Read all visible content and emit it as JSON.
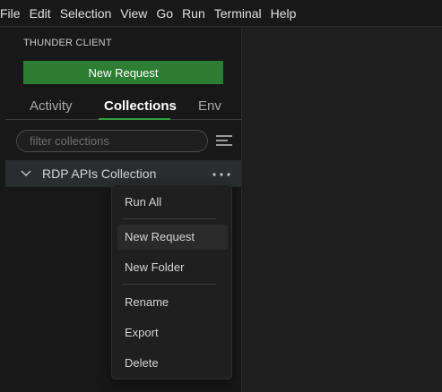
{
  "menubar": {
    "items": [
      "File",
      "Edit",
      "Selection",
      "View",
      "Go",
      "Run",
      "Terminal",
      "Help"
    ]
  },
  "sidebar": {
    "title": "THUNDER CLIENT",
    "new_request_label": "New Request",
    "tabs": [
      {
        "label": "Activity",
        "active": false
      },
      {
        "label": "Collections",
        "active": true
      },
      {
        "label": "Env",
        "active": false
      }
    ],
    "filter_placeholder": "filter collections",
    "collection": {
      "name": "RDP APIs Collection",
      "expanded": false
    }
  },
  "context_menu": {
    "items": [
      {
        "label": "Run All"
      },
      {
        "label": "New Request",
        "hovered": true
      },
      {
        "label": "New Folder"
      },
      {
        "label": "Rename"
      },
      {
        "label": "Export"
      },
      {
        "label": "Delete"
      }
    ]
  },
  "colors": {
    "accent_green": "#2d7d32",
    "tab_underline": "#2ea043",
    "background": "#1f1f1f",
    "sidebar_bg": "#181818"
  },
  "icons": [
    "sort-lines-icon",
    "chevron-down-icon",
    "more-dots-icon"
  ]
}
